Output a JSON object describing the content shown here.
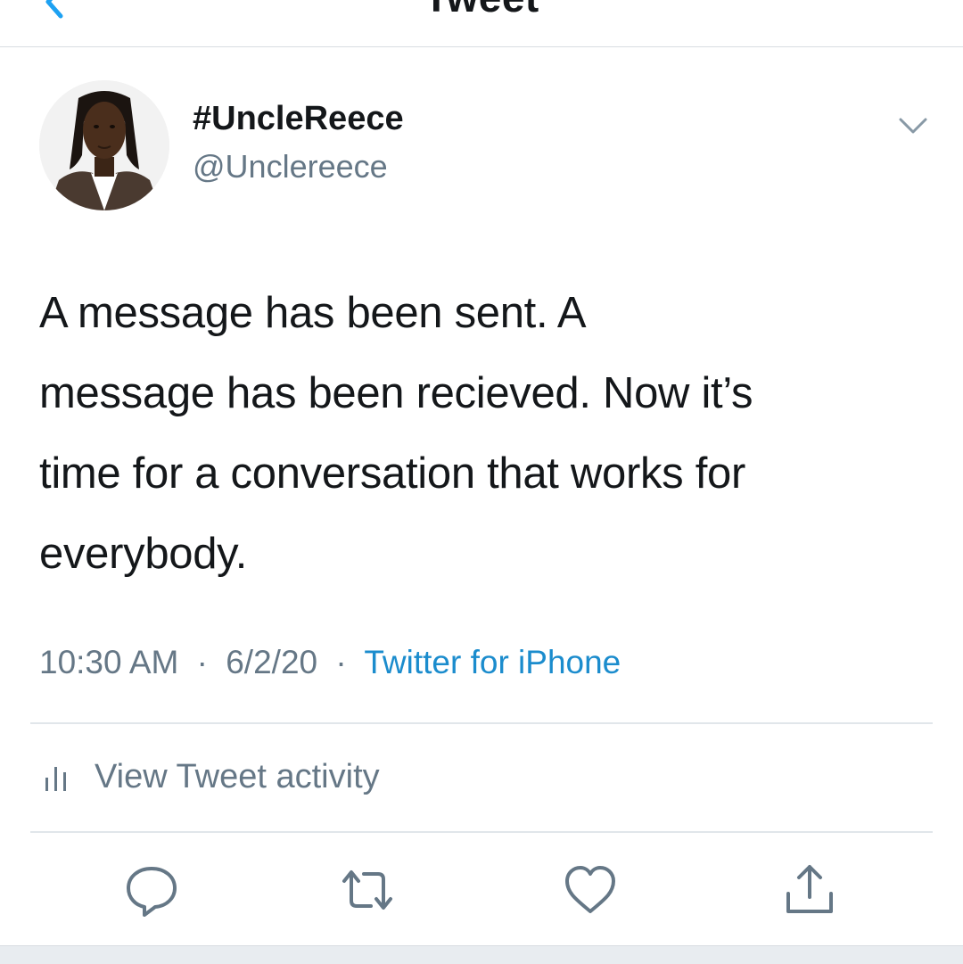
{
  "header": {
    "title": "Tweet"
  },
  "tweet": {
    "display_name": "#UncleReece",
    "handle": "@Unclereece",
    "text": "A message has been sent. A\nmessage has been recieved. Now it’s\ntime for a conversation that works for\neverybody.",
    "time": "10:30 AM",
    "date": "6/2/20",
    "separator": "·",
    "source": "Twitter for iPhone"
  },
  "activity": {
    "label": "View Tweet activity"
  },
  "actions": {
    "reply_icon": "reply-icon",
    "retweet_icon": "retweet-icon",
    "like_icon": "heart-icon",
    "share_icon": "share-icon"
  },
  "colors": {
    "accent": "#1b8ccd",
    "text": "#14171a",
    "secondary": "#657786"
  }
}
